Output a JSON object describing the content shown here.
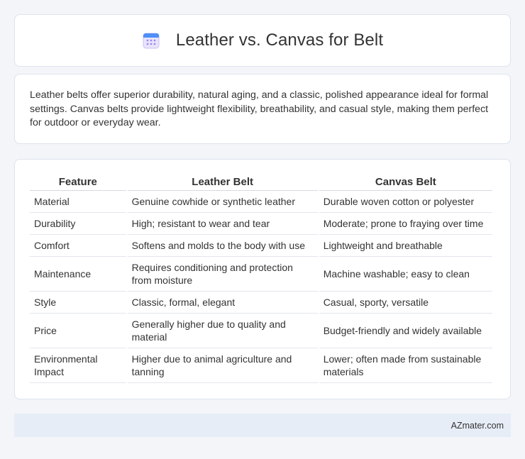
{
  "header": {
    "title": "Leather vs. Canvas for Belt",
    "icon": "calendar-icon",
    "icon_color": "#7b6cf0"
  },
  "summary": "Leather belts offer superior durability, natural aging, and a classic, polished appearance ideal for formal settings. Canvas belts provide lightweight flexibility, breathability, and casual style, making them perfect for outdoor or everyday wear.",
  "table": {
    "headers": [
      "Feature",
      "Leather Belt",
      "Canvas Belt"
    ],
    "rows": [
      [
        "Material",
        "Genuine cowhide or synthetic leather",
        "Durable woven cotton or polyester"
      ],
      [
        "Durability",
        "High; resistant to wear and tear",
        "Moderate; prone to fraying over time"
      ],
      [
        "Comfort",
        "Softens and molds to the body with use",
        "Lightweight and breathable"
      ],
      [
        "Maintenance",
        "Requires conditioning and protection from moisture",
        "Machine washable; easy to clean"
      ],
      [
        "Style",
        "Classic, formal, elegant",
        "Casual, sporty, versatile"
      ],
      [
        "Price",
        "Generally higher due to quality and material",
        "Budget-friendly and widely available"
      ],
      [
        "Environmental Impact",
        "Higher due to animal agriculture and tanning",
        "Lower; often made from sustainable materials"
      ]
    ]
  },
  "footer": {
    "brand": "AZmater.com"
  }
}
